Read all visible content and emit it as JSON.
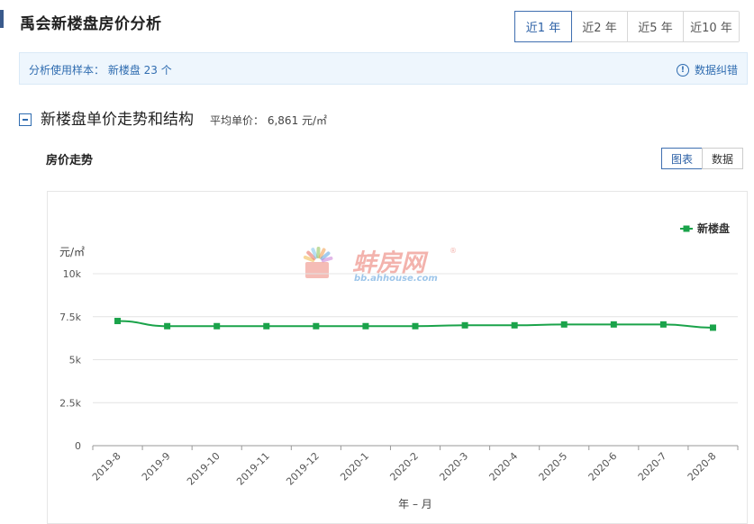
{
  "header": {
    "title": "禹会新楼盘房价分析",
    "range_tabs": [
      {
        "label": "近1 年",
        "active": true
      },
      {
        "label": "近2 年",
        "active": false
      },
      {
        "label": "近5 年",
        "active": false
      },
      {
        "label": "近10 年",
        "active": false
      }
    ]
  },
  "sample_bar": {
    "label": "分析使用样本：",
    "value": "新楼盘 23 个",
    "correction": "数据纠错"
  },
  "section": {
    "title": "新楼盘单价走势和结构",
    "avg_label": "平均单价：",
    "avg_value": "6,861 元/㎡"
  },
  "trend": {
    "title": "房价走势",
    "view_chart": "图表",
    "view_data": "数据"
  },
  "watermark": {
    "name": "蚌房网",
    "domain": "bb.ahhouse.com",
    "mark": "®"
  },
  "colors": {
    "accent": "#2f6cb0",
    "series": "#1aa34a",
    "grid": "#e4e4e4"
  },
  "chart_data": {
    "type": "line",
    "ylabel": "元/㎡",
    "xlabel": "年 – 月",
    "ylim": [
      0,
      10000
    ],
    "ytick_values": [
      0,
      2500,
      5000,
      7500,
      10000
    ],
    "ytick_labels": [
      "0",
      "2.5k",
      "5k",
      "7.5k",
      "10k"
    ],
    "categories": [
      "2019-8",
      "2019-9",
      "2019-10",
      "2019-11",
      "2019-12",
      "2020-1",
      "2020-2",
      "2020-3",
      "2020-4",
      "2020-5",
      "2020-6",
      "2020-7",
      "2020-8"
    ],
    "series": [
      {
        "name": "新楼盘",
        "values": [
          7250,
          6950,
          6950,
          6950,
          6950,
          6950,
          6950,
          7000,
          7000,
          7050,
          7050,
          7050,
          6861
        ]
      }
    ],
    "grid": true,
    "legend": "top-right"
  }
}
